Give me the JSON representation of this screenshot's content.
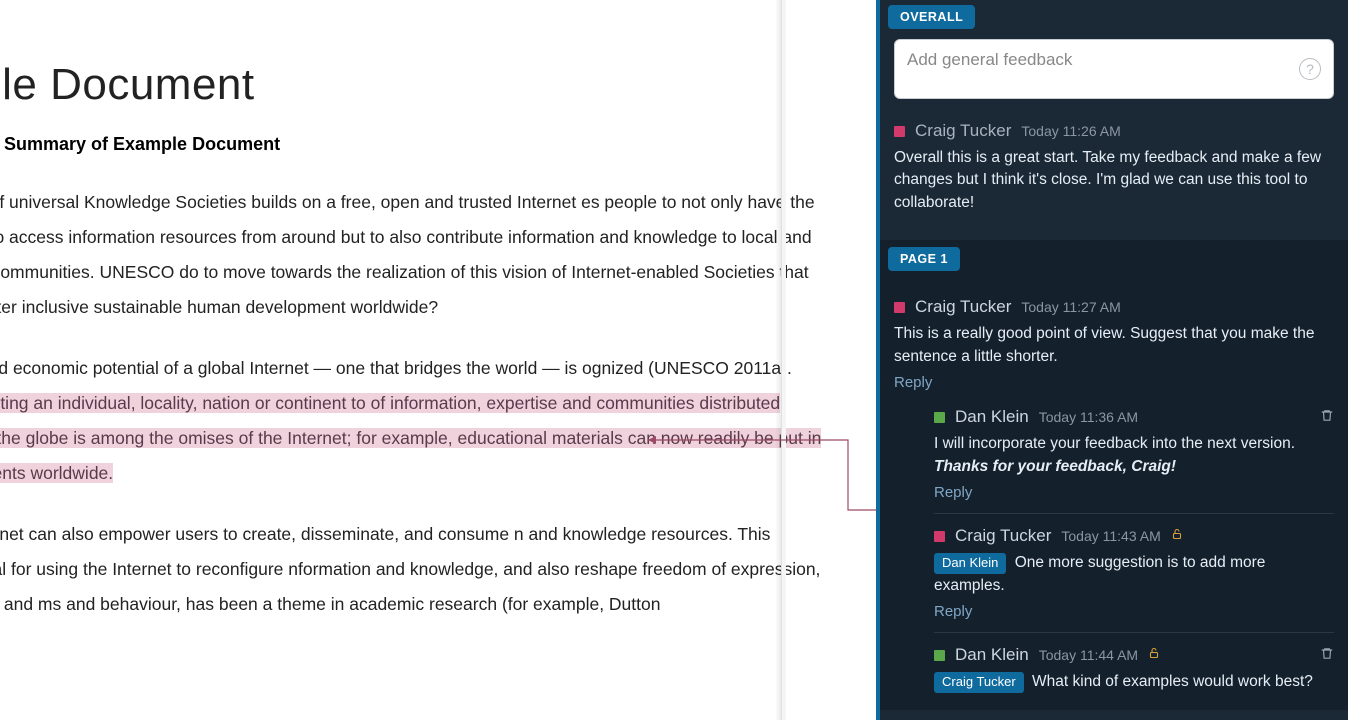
{
  "document": {
    "title": "mple Document",
    "subtitle": "Summary of Example Document",
    "para1_a": "vision of universal Knowledge Societies builds on a free, open and trusted Internet es people to not only have the ability to access information resources from around but to also contribute information and knowledge to local and global communities. UNESCO do to move towards the realization of this vision of Internet-enabled  Societies that can foster inclusive sustainable human development worldwide?",
    "para2_a": "civic and economic potential of a global Internet — one that bridges the world — is ognized (UNESCO 2011a). ",
    "para2_hl": "Connecting an individual, locality, nation or continent to  of information, expertise and communities distributed across the globe is among the omises of the Internet; for example, educational materials can now readily be put in of students worldwide.",
    "para3": "he Internet can also empower users to create, disseminate, and consume n and knowledge resources. This potential for using the Internet to reconfigure nformation and knowledge, and also reshape freedom of expression, privacy, and ms and behaviour, has been a theme in academic research (for example, Dutton"
  },
  "feedback": {
    "overall_badge": "OVERALL",
    "page1_badge": "PAGE 1",
    "placeholder": "Add general feedback",
    "help_glyph": "?",
    "reply_label": "Reply",
    "overall_comment": {
      "author": "Craig Tucker",
      "ts": "Today 11:26 AM",
      "text": "Overall this is a great start. Take my feedback and make a few changes but I think it's close. I'm glad we can use this tool to collaborate!"
    },
    "p1_root": {
      "author": "Craig Tucker",
      "ts": "Today 11:27 AM",
      "text": "This is a really good point of view. Suggest that you make the sentence a little shorter."
    },
    "p1_replies": [
      {
        "author": "Dan Klein",
        "ts": "Today 11:36 AM",
        "swatch": "green",
        "trash": true,
        "text_plain": "I will incorporate your feedback into the next version.",
        "text_emph": "Thanks for your feedback, Craig!"
      },
      {
        "author": "Craig Tucker",
        "ts": "Today 11:43 AM",
        "swatch": "pink",
        "lock": true,
        "mention": "Dan Klein",
        "text_plain": "One more suggestion is to add more examples."
      },
      {
        "author": "Dan Klein",
        "ts": "Today 11:44 AM",
        "swatch": "green",
        "lock": true,
        "trash": true,
        "mention": "Craig Tucker",
        "text_plain": "What kind of examples would work best?"
      }
    ]
  }
}
